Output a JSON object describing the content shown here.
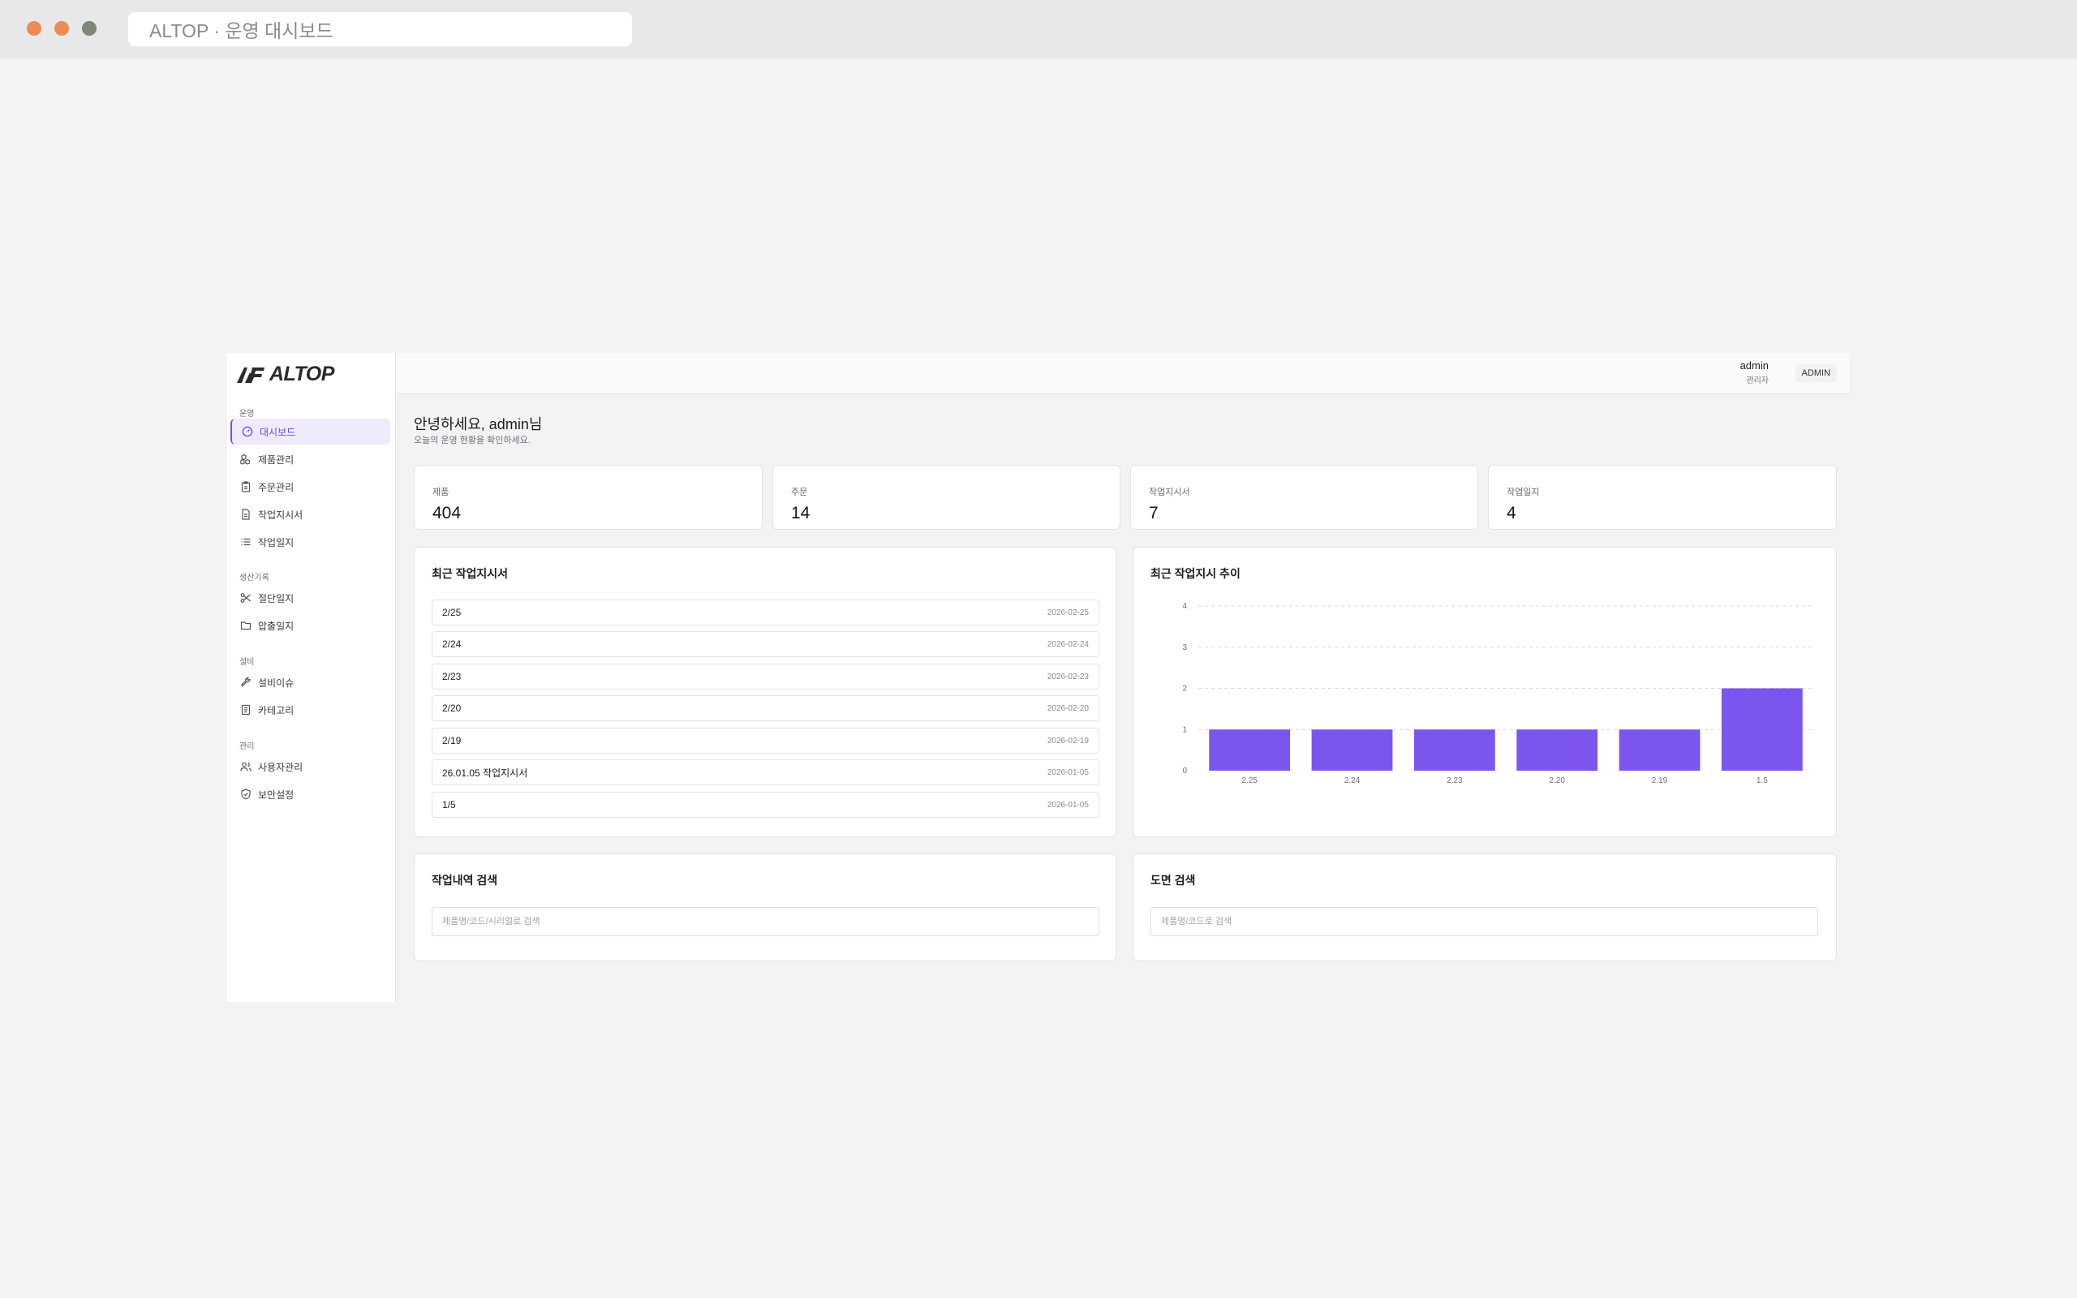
{
  "browser": {
    "url_title": "ALTOP · 운영 대시보드"
  },
  "brand": {
    "logo_text": "ALTOP"
  },
  "sidebar": {
    "sections": [
      {
        "label": "운영",
        "items": [
          {
            "label": "대시보드",
            "icon": "gauge-icon",
            "active": true
          },
          {
            "label": "제품관리",
            "icon": "boxes-icon"
          },
          {
            "label": "주문관리",
            "icon": "clipboard-icon"
          },
          {
            "label": "작업지시서",
            "icon": "document-icon"
          },
          {
            "label": "작업일지",
            "icon": "list-icon"
          }
        ]
      },
      {
        "label": "생산기록",
        "items": [
          {
            "label": "절단일지",
            "icon": "scissors-icon"
          },
          {
            "label": "압출일지",
            "icon": "folder-icon"
          }
        ]
      },
      {
        "label": "설비",
        "items": [
          {
            "label": "설비이슈",
            "icon": "wrench-icon"
          },
          {
            "label": "카테고리",
            "icon": "book-icon"
          }
        ]
      },
      {
        "label": "관리",
        "items": [
          {
            "label": "사용자관리",
            "icon": "users-icon"
          },
          {
            "label": "보안설정",
            "icon": "shield-icon"
          }
        ]
      }
    ]
  },
  "header": {
    "user_name": "admin",
    "user_role": "관리자",
    "role_badge": "ADMIN"
  },
  "main": {
    "greeting": "안녕하세요, admin님",
    "sub_greeting": "오늘의 운영 현황을 확인하세요.",
    "stats": [
      {
        "label": "제품",
        "value": "404"
      },
      {
        "label": "주문",
        "value": "14"
      },
      {
        "label": "작업지시서",
        "value": "7"
      },
      {
        "label": "작업일지",
        "value": "4"
      }
    ],
    "recent_orders": {
      "title": "최근 작업지시서",
      "rows": [
        {
          "label": "2/25",
          "date": "2026-02-25"
        },
        {
          "label": "2/24",
          "date": "2026-02-24"
        },
        {
          "label": "2/23",
          "date": "2026-02-23"
        },
        {
          "label": "2/20",
          "date": "2026-02-20"
        },
        {
          "label": "2/19",
          "date": "2026-02-19"
        },
        {
          "label": "26.01.05 작업지시서",
          "date": "2026-01-05"
        },
        {
          "label": "1/5",
          "date": "2026-01-05"
        }
      ]
    },
    "trend": {
      "title": "최근 작업지시 추이"
    },
    "work_search": {
      "title": "작업내역 검색",
      "placeholder": "제품명/코드/시리얼로 검색"
    },
    "drawing_search": {
      "title": "도면 검색",
      "placeholder": "제품명/코드로 검색"
    }
  },
  "colors": {
    "accent": "#7752ea",
    "bar": "#7b55ee"
  },
  "chart_data": {
    "type": "bar",
    "title": "최근 작업지시 추이",
    "categories": [
      "2.25",
      "2.24",
      "2.23",
      "2.20",
      "2.19",
      "1.5"
    ],
    "values": [
      1,
      1,
      1,
      1,
      1,
      2
    ],
    "ylim": [
      0,
      4
    ],
    "yticks": [
      0,
      1,
      2,
      3,
      4
    ],
    "grid": true
  }
}
